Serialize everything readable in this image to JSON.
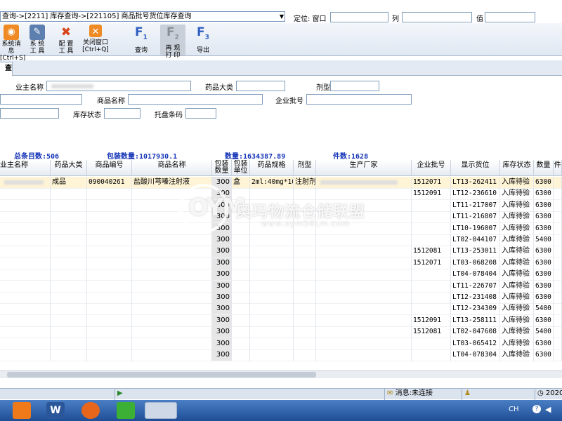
{
  "address": {
    "path": "查询->[2211] 库存查询->[221105] 商品批号货位库存查询"
  },
  "locate": {
    "label": "定位: 窗口",
    "col_label": "列",
    "value_label": "值"
  },
  "toolbar": {
    "buttons": [
      {
        "label": "系统消息",
        "sub": "[Ctrl+S]"
      },
      {
        "label": "系 统",
        "sub": "工 具"
      },
      {
        "label": "配 置",
        "sub": "工 具"
      },
      {
        "label": "关闭窗口",
        "sub": "[Ctrl+Q]"
      },
      {
        "key": "F",
        "num": "1",
        "label": "查询"
      },
      {
        "key": "F",
        "num": "2",
        "label": "再 现",
        "sub": "打 印"
      },
      {
        "key": "F",
        "num": "3",
        "label": "导出"
      }
    ]
  },
  "tab": {
    "label": "查询"
  },
  "filters": {
    "owner_name": "业主名称",
    "drug_category": "药品大类",
    "dosage_form": "剂型",
    "product_name": "商品名称",
    "company_batch": "企业批号",
    "stock_status": "库存状态",
    "pallet_code": "托盘条码"
  },
  "summary": {
    "total": "总条目数:506",
    "pack_qty": "包装数量:1017930.1",
    "quantity": "数量:1634387.89",
    "pieces": "件数:1628"
  },
  "grid": {
    "headers": [
      "业主名称",
      "药品大类",
      "商品编号",
      "商品名称",
      "包装数量",
      "包装单位",
      "药品规格",
      "剂型",
      "生产厂家",
      "企业批号",
      "显示货位",
      "库存状态",
      "数量",
      "件"
    ],
    "first_row": {
      "category": "成品",
      "code": "090040261",
      "name": "盐酸川芎嗪注射液",
      "unit": "盒",
      "spec": "2ml:40mg*10",
      "form": "注射剂"
    },
    "rows": [
      {
        "pack": "300",
        "batch": "1512071",
        "loc": "LT13-262411",
        "status": "入库待验",
        "qty": "6300"
      },
      {
        "pack": "300",
        "batch": "1512091",
        "loc": "LT12-236610",
        "status": "入库待验",
        "qty": "6300"
      },
      {
        "pack": "300",
        "batch": "",
        "loc": "LT11-217007",
        "status": "入库待验",
        "qty": "6300"
      },
      {
        "pack": "300",
        "batch": "",
        "loc": "LT11-216807",
        "status": "入库待验",
        "qty": "6300"
      },
      {
        "pack": "300",
        "batch": "",
        "loc": "LT10-196007",
        "status": "入库待验",
        "qty": "6300"
      },
      {
        "pack": "300",
        "batch": "",
        "loc": "LT02-044107",
        "status": "入库待验",
        "qty": "5400"
      },
      {
        "pack": "300",
        "batch": "1512081",
        "loc": "LT13-253011",
        "status": "入库待验",
        "qty": "6300"
      },
      {
        "pack": "300",
        "batch": "1512071",
        "loc": "LT03-068208",
        "status": "入库待验",
        "qty": "6300"
      },
      {
        "pack": "300",
        "batch": "",
        "loc": "LT04-078404",
        "status": "入库待验",
        "qty": "6300"
      },
      {
        "pack": "300",
        "batch": "",
        "loc": "LT11-226707",
        "status": "入库待验",
        "qty": "6300"
      },
      {
        "pack": "300",
        "batch": "",
        "loc": "LT12-231408",
        "status": "入库待验",
        "qty": "6300"
      },
      {
        "pack": "300",
        "batch": "",
        "loc": "LT12-234309",
        "status": "入库待验",
        "qty": "5400"
      },
      {
        "pack": "300",
        "batch": "1512091",
        "loc": "LT13-258111",
        "status": "入库待验",
        "qty": "6300"
      },
      {
        "pack": "300",
        "batch": "1512081",
        "loc": "LT02-047608",
        "status": "入库待验",
        "qty": "5400"
      },
      {
        "pack": "300",
        "batch": "",
        "loc": "LT03-065412",
        "status": "入库待验",
        "qty": "6300"
      },
      {
        "pack": "300",
        "batch": "",
        "loc": "LT04-078304",
        "status": "入库待验",
        "qty": "6300"
      }
    ]
  },
  "status": {
    "message": "消息:未连接",
    "date": "2020"
  },
  "watermark": {
    "logo": "OYM",
    "text": "奥玛物流仓储联盟",
    "url": "www.oym56Lm.com"
  },
  "taskbar": {
    "lang": "CH"
  },
  "colors": {
    "summary_text": "#1534b8",
    "selected_row": "#fff4d6",
    "taskbar": "#2b5ea8"
  }
}
